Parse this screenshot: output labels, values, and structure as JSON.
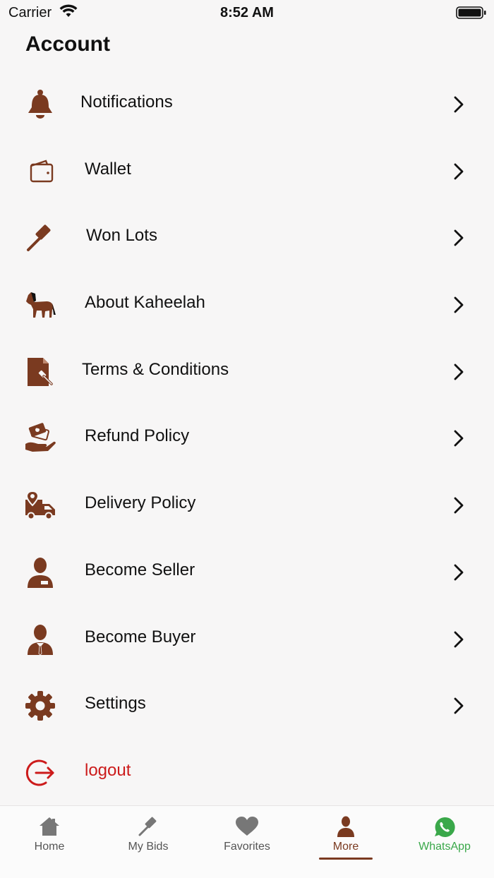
{
  "status": {
    "carrier": "Carrier",
    "time": "8:52 AM"
  },
  "page": {
    "title": "Account"
  },
  "colors": {
    "accent": "#7a3a20",
    "logout": "#cc1b1b",
    "whatsapp": "#3aa84a",
    "background": "#f7f6f6"
  },
  "menu": [
    {
      "label": "Notifications",
      "icon": "bell-icon"
    },
    {
      "label": "Wallet",
      "icon": "wallet-icon"
    },
    {
      "label": "Won Lots",
      "icon": "gavel-icon"
    },
    {
      "label": "About Kaheelah",
      "icon": "horse-icon"
    },
    {
      "label": "Terms & Conditions",
      "icon": "document-gavel-icon"
    },
    {
      "label": "Refund Policy",
      "icon": "hand-money-icon"
    },
    {
      "label": "Delivery Policy",
      "icon": "delivery-truck-icon"
    },
    {
      "label": "Become Seller",
      "icon": "seller-icon"
    },
    {
      "label": "Become Buyer",
      "icon": "buyer-icon"
    },
    {
      "label": "Settings",
      "icon": "gear-icon"
    },
    {
      "label": "logout",
      "icon": "logout-icon"
    }
  ],
  "tabs": [
    {
      "label": "Home",
      "icon": "home-icon"
    },
    {
      "label": "My Bids",
      "icon": "gavel-icon"
    },
    {
      "label": "Favorites",
      "icon": "heart-icon"
    },
    {
      "label": "More",
      "icon": "person-icon",
      "active": true
    },
    {
      "label": "WhatsApp",
      "icon": "whatsapp-icon"
    }
  ]
}
